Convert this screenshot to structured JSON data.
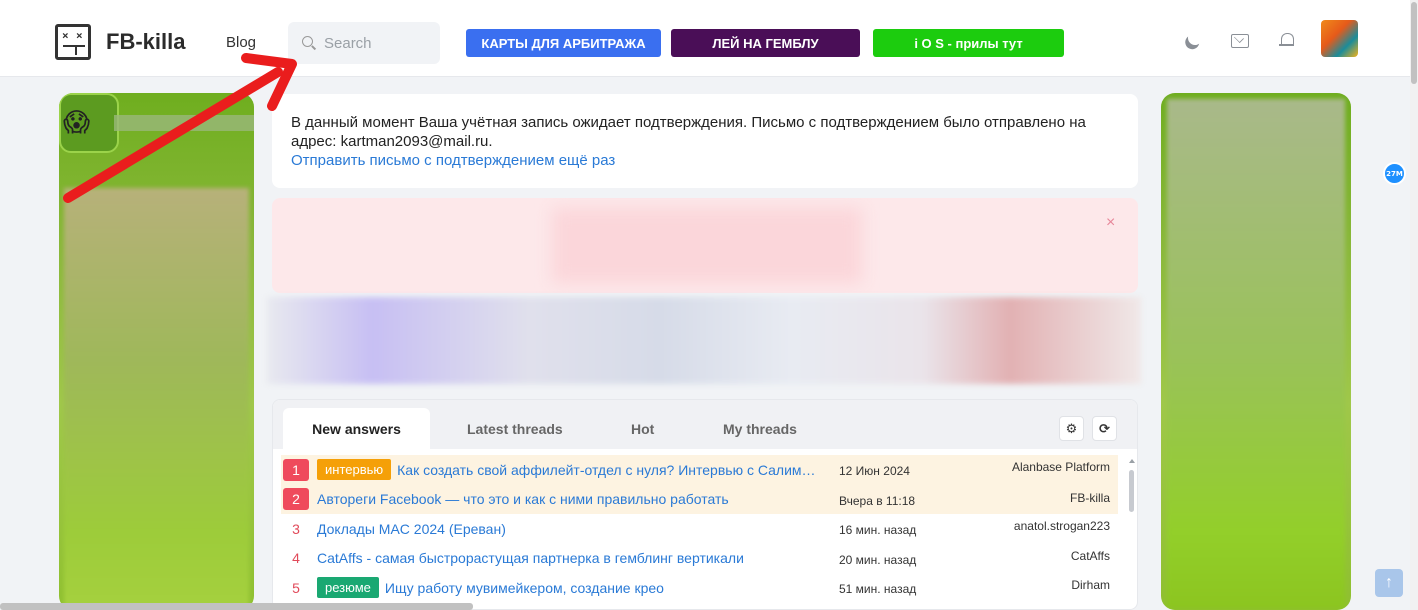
{
  "header": {
    "logo_text": "FB-killa",
    "nav_blog": "Blog",
    "search_placeholder": "Search",
    "promo_buttons": [
      {
        "label": "КАРТЫ ДЛЯ АРБИТРАЖА",
        "color": "#3a6ff0"
      },
      {
        "label": "ЛЕЙ НА ГЕМБЛУ",
        "color": "#4a0e57"
      },
      {
        "label": "i O S - прилы тут",
        "color": "#1ccc0e"
      }
    ],
    "icons": [
      "moon-icon",
      "mail-icon",
      "bell-icon"
    ]
  },
  "side_badge": "27M",
  "notice": {
    "message": "В данный момент Ваша учётная запись ожидает подтверждения. Письмо с подтверждением было отправлено на адрес: kartman2093@mail.ru.",
    "resend_link": "Отправить письмо с подтверждением ещё раз"
  },
  "alert": {
    "close_glyph": "×"
  },
  "threads": {
    "tabs": [
      {
        "label": "New answers",
        "active": true
      },
      {
        "label": "Latest threads",
        "active": false
      },
      {
        "label": "Hot",
        "active": false
      },
      {
        "label": "My threads",
        "active": false
      }
    ],
    "rows": [
      {
        "num": "1",
        "prefix": "интервью",
        "prefix_color": "#f5a008",
        "title": "Как создать свой аффилейт-отдел с нуля? Интервью с Салимом...",
        "date": "12 Июн 2024",
        "author": "Alanbase Platform",
        "highlight": true
      },
      {
        "num": "2",
        "prefix": "",
        "title": "Автореги Facebook — что это и как с ними правильно работать",
        "date": "Вчера в 11:18",
        "author": "FB-killa",
        "highlight": true
      },
      {
        "num": "3",
        "prefix": "",
        "title": "Доклады MAC 2024 (Ереван)",
        "date": "16 мин. назад",
        "author": "anatol.strogan223",
        "highlight": false
      },
      {
        "num": "4",
        "prefix": "",
        "title": "CatAffs - самая быстрорастущая партнерка в гемблинг вертикали",
        "date": "20 мин. назад",
        "author": "CatAffs",
        "highlight": false
      },
      {
        "num": "5",
        "prefix": "резюме",
        "prefix_color": "#1aa872",
        "title": "Ищу работу мувимейкером, создание крео",
        "date": "51 мин. назад",
        "author": "Dirham",
        "highlight": false
      }
    ]
  }
}
